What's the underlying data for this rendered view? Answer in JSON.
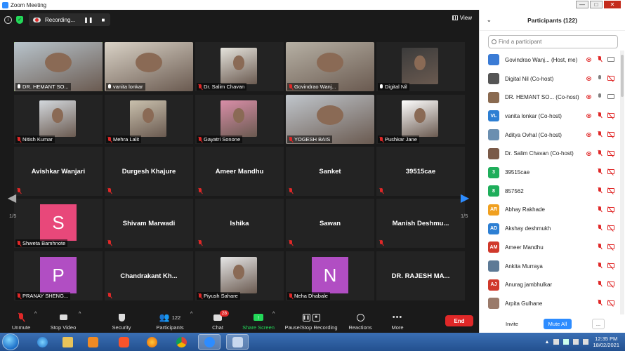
{
  "window": {
    "title": "Zoom Meeting",
    "controls": [
      "—",
      "□",
      "✕"
    ]
  },
  "meeting_bar": {
    "recording_label": "Recording...",
    "pause_symbol": "❚❚",
    "stop_symbol": "■",
    "view_label": "View",
    "info_symbol": "i",
    "secure_symbol": "✓"
  },
  "gallery": {
    "page_left": "1/5",
    "page_right": "1/5",
    "nav_left": "◀",
    "nav_right": "▶",
    "tiles": [
      {
        "label": "DR. HEMANT SO...",
        "muted": false,
        "video": true,
        "active": true
      },
      {
        "label": "vanita lonkar",
        "muted": false,
        "video": true
      },
      {
        "label": "Dr. Salim Chavan",
        "muted": true,
        "video": true
      },
      {
        "label": "Govindrao Wanj...",
        "muted": true,
        "video": true
      },
      {
        "label": "Digital Nil",
        "muted": false,
        "video": true
      },
      {
        "label": "Nitish Kumar",
        "muted": true,
        "video": true
      },
      {
        "label": "Mehra Lalit",
        "muted": true,
        "video": true
      },
      {
        "label": "Gayatri Sonone",
        "muted": true,
        "video": true
      },
      {
        "label": "YOGESH BAIS",
        "muted": true,
        "video": true
      },
      {
        "label": "Pushkar Jane",
        "muted": true,
        "video": true
      },
      {
        "name": "Avishkar Wanjari",
        "muted": true
      },
      {
        "name": "Durgesh Khajure",
        "muted": true
      },
      {
        "name": "Ameer Mandhu",
        "muted": true
      },
      {
        "name": "Sanket",
        "muted": true
      },
      {
        "name": "39515cae",
        "muted": true
      },
      {
        "label": "Shweta Bamhnote",
        "muted": true,
        "avatar_letter": "S",
        "avatar_color": "#e8487a"
      },
      {
        "name": "Shivam Marwadi",
        "muted": true
      },
      {
        "name": "Ishika",
        "muted": true
      },
      {
        "name": "Sawan",
        "muted": true
      },
      {
        "name": "Manish  Deshmu...",
        "muted": true
      },
      {
        "label": "PRANAY SHENG...",
        "muted": true,
        "avatar_letter": "P",
        "avatar_color": "#b14ec3"
      },
      {
        "name": "Chandrakant  Kh...",
        "muted": true
      },
      {
        "label": "Piyush Sahare",
        "muted": true,
        "video": true
      },
      {
        "label": "Neha Dhabale",
        "muted": true,
        "avatar_letter": "N",
        "avatar_color": "#b14ec3"
      },
      {
        "name": "DR. RAJESH MA...",
        "muted": false
      }
    ]
  },
  "toolbar": {
    "unmute": "Unmute",
    "stop_video": "Stop Video",
    "security": "Security",
    "participants": "Participants",
    "participants_count": "122",
    "chat": "Chat",
    "chat_badge": "28",
    "share_screen": "Share Screen",
    "pause_recording": "Pause/Stop Recording",
    "reactions": "Reactions",
    "more": "More",
    "end": "End",
    "caret": "^"
  },
  "panel": {
    "title": "Participants (122)",
    "chevron": "⌄",
    "search_placeholder": "Find a participant",
    "participants": [
      {
        "name": "Govindrao Wanj...  (Host, me)",
        "initials": "",
        "color": "#3a7bd5",
        "rec": true,
        "mic": "off",
        "cam": "on"
      },
      {
        "name": "Digital Nil (Co-host)",
        "initials": "",
        "color": "#555",
        "rec": true,
        "mic": "on",
        "cam": "off"
      },
      {
        "name": "DR. HEMANT SO...  (Co-host)",
        "initials": "",
        "color": "#8a6a50",
        "rec": true,
        "mic": "on",
        "cam": "on"
      },
      {
        "name": "vanita lonkar (Co-host)",
        "initials": "VL",
        "color": "#2d7fd3",
        "rec": true,
        "mic": "off",
        "cam": "off"
      },
      {
        "name": "Aditya Ovhal (Co-host)",
        "initials": "",
        "color": "#6b8fb0",
        "rec": true,
        "mic": "off",
        "cam": "off"
      },
      {
        "name": "Dr. Salim Chavan (Co-host)",
        "initials": "",
        "color": "#7a5a48",
        "rec": true,
        "mic": "off",
        "cam": "off"
      },
      {
        "name": "39515cae",
        "initials": "3",
        "color": "#1fae5b",
        "rec": false,
        "mic": "off",
        "cam": "off"
      },
      {
        "name": "857562",
        "initials": "8",
        "color": "#1fae5b",
        "rec": false,
        "mic": "off",
        "cam": "off"
      },
      {
        "name": "Abhay Rakhade",
        "initials": "AR",
        "color": "#f0a020",
        "rec": false,
        "mic": "off",
        "cam": "off"
      },
      {
        "name": "Akshay deshmukh",
        "initials": "AD",
        "color": "#2d7fd3",
        "rec": false,
        "mic": "off",
        "cam": "off"
      },
      {
        "name": "Ameer Mandhu",
        "initials": "AM",
        "color": "#d0392b",
        "rec": false,
        "mic": "off",
        "cam": "off"
      },
      {
        "name": "Ankita Murraya",
        "initials": "",
        "color": "#5d7a96",
        "rec": false,
        "mic": "off",
        "cam": "off"
      },
      {
        "name": "Anurag jambhulkar",
        "initials": "AJ",
        "color": "#d0392b",
        "rec": false,
        "mic": "off",
        "cam": "off"
      },
      {
        "name": "Arpita Gulhane",
        "initials": "",
        "color": "#9a7a6a",
        "rec": false,
        "mic": "off",
        "cam": "off"
      }
    ],
    "invite": "Invite",
    "mute_all": "Mute All",
    "more": "..."
  },
  "taskbar": {
    "clock_time": "12:35 PM",
    "clock_date": "18/02/2021",
    "tray_up": "▲"
  }
}
